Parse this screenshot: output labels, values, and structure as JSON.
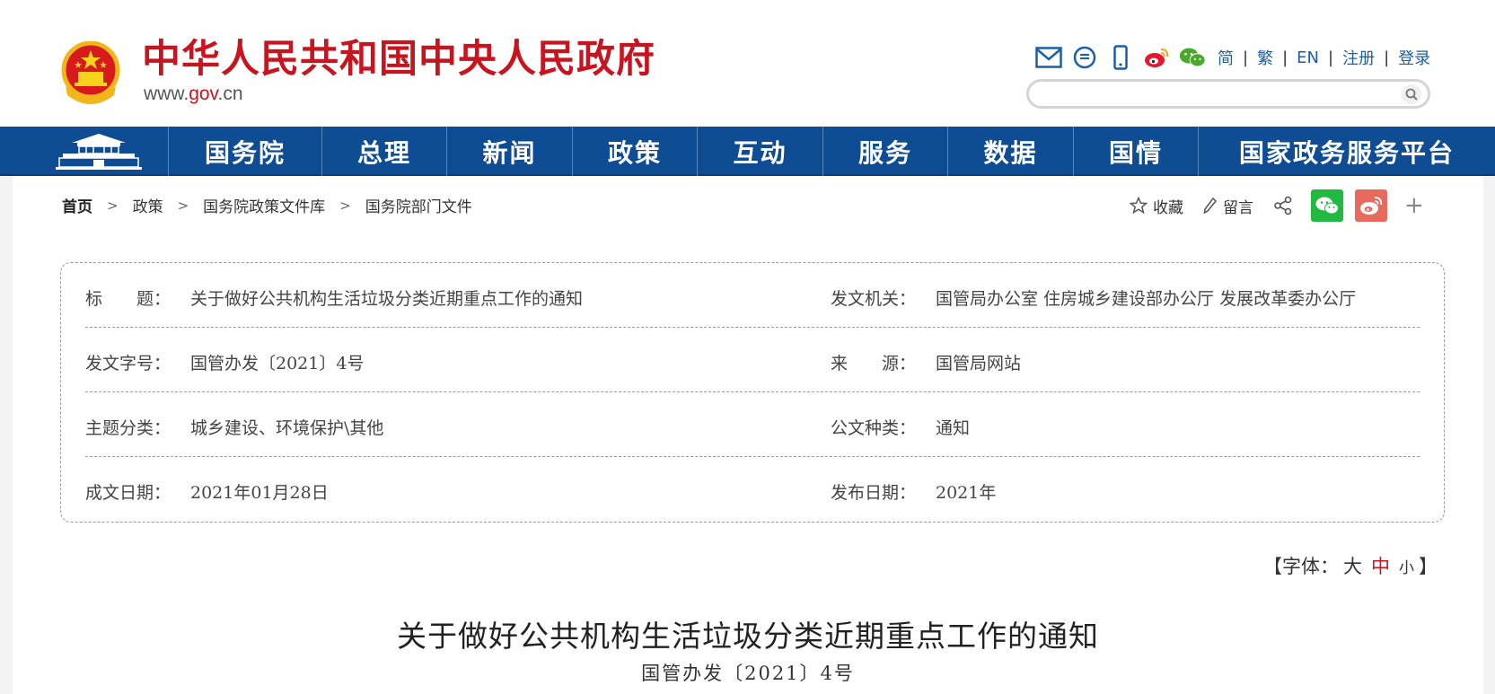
{
  "header": {
    "site_title": "中华人民共和国中央人民政府",
    "url_prefix": "www.",
    "url_gov": "gov",
    "url_suffix": ".cn",
    "tool_icons": [
      "mail-icon",
      "message-icon",
      "mobile-icon",
      "weibo-icon",
      "wechat-icon"
    ],
    "lang_links": [
      "简",
      "繁",
      "EN",
      "注册",
      "登录"
    ],
    "search_placeholder": ""
  },
  "nav": {
    "items": [
      "国务院",
      "总理",
      "新闻",
      "政策",
      "互动",
      "服务",
      "数据",
      "国情",
      "国家政务服务平台"
    ]
  },
  "breadcrumb": [
    "首页",
    "政策",
    "国务院政策文件库",
    "国务院部门文件"
  ],
  "share": {
    "favorite_label": "收藏",
    "comment_label": "留言",
    "plus": "+"
  },
  "info": {
    "rows": [
      {
        "left_label": "标　　题：",
        "left_value": "关于做好公共机构生活垃圾分类近期重点工作的通知",
        "right_label": "发文机关：",
        "right_value": "国管局办公室 住房城乡建设部办公厅 发展改革委办公厅"
      },
      {
        "left_label": "发文字号：",
        "left_value": "国管办发〔2021〕4号",
        "right_label": "来　　源：",
        "right_value": "国管局网站"
      },
      {
        "left_label": "主题分类：",
        "left_value": "城乡建设、环境保护\\其他",
        "right_label": "公文种类：",
        "right_value": "通知"
      },
      {
        "left_label": "成文日期：",
        "left_value": "2021年01月28日",
        "right_label": "发布日期：",
        "right_value": "2021年"
      }
    ]
  },
  "font_size": {
    "open": "【字体：",
    "large": "大",
    "medium": "中",
    "small": "小",
    "close": "】"
  },
  "document": {
    "title": "关于做好公共机构生活垃圾分类近期重点工作的通知",
    "number": "国管办发〔2021〕4号"
  },
  "colors": {
    "brand_red": "#c8141f",
    "nav_blue": "#0e4c93",
    "link_blue": "#1a5fa8"
  }
}
